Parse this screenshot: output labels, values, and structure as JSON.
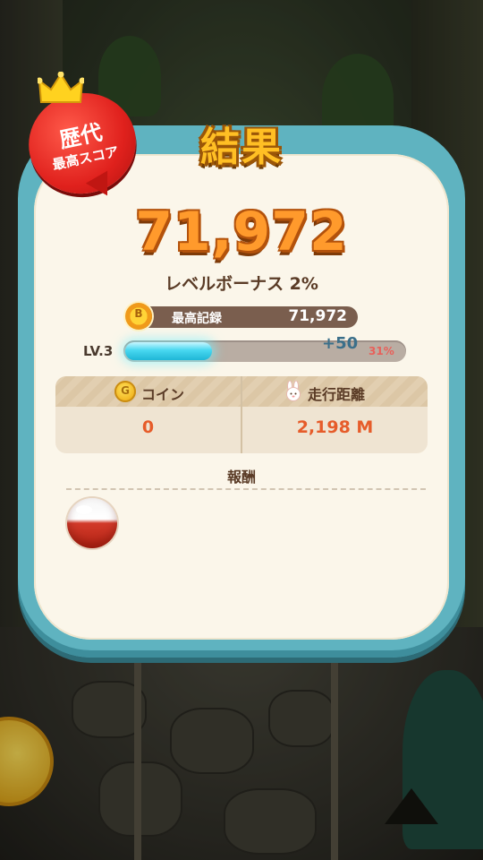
{
  "result": {
    "title": "結果",
    "record_badge": {
      "line1": "歴代",
      "line2": "最高スコア"
    },
    "score": "71,972",
    "level_bonus": "レベルボーナス 2%",
    "best_record": {
      "label": "最高記録",
      "value": "71,972",
      "icon": "medal-icon",
      "icon_glyph": "B"
    },
    "experience": {
      "level": "LV.3",
      "gain": "+50",
      "percent_label": "31%",
      "fill_fraction": 0.31
    },
    "stats": {
      "coin": {
        "label": "コイン",
        "value": "0",
        "icon": "coin-icon",
        "icon_glyph": "G"
      },
      "distance": {
        "label": "走行距離",
        "value": "2,198 M",
        "icon": "bunny-icon"
      }
    },
    "reward": {
      "title": "報酬",
      "items": [
        {
          "icon": "capsule-egg-icon"
        }
      ]
    }
  },
  "colors": {
    "panel_border": "#5fb3c0",
    "panel_fill": "#fbf6ea",
    "score_orange": "#ff9a2c",
    "value_red": "#e65c2a",
    "exp_cyan": "#47d7f0"
  }
}
